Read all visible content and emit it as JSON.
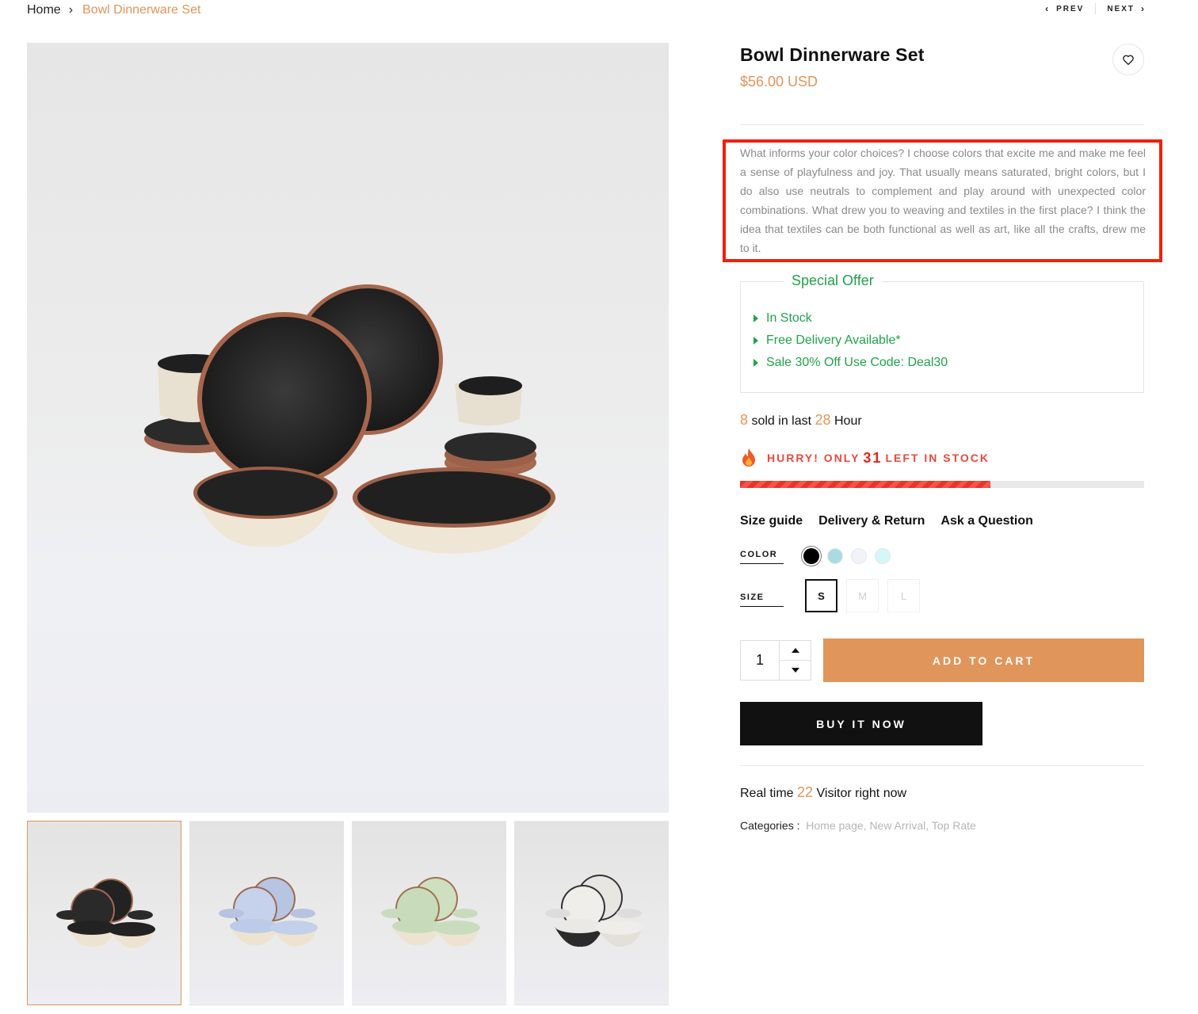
{
  "breadcrumb": {
    "home": "Home",
    "separator": "›",
    "current": "Bowl Dinnerware Set"
  },
  "pager": {
    "prev": "PREV",
    "next": "NEXT"
  },
  "product": {
    "title": "Bowl Dinnerware Set",
    "price": "$56.00 USD",
    "description": "What informs your color choices? I choose colors that excite me and make me feel a sense of playfulness and joy. That usually means saturated, bright colors, but I do also use neutrals to complement and play around with unexpected color combinations. What drew you to weaving and textiles in the first place? I think the idea that textiles can be both functional as well as art, like all the crafts, drew me to it."
  },
  "offer": {
    "title": "Special Offer",
    "items": [
      "In Stock",
      "Free Delivery Available*",
      "Sale 30% Off Use Code: Deal30"
    ]
  },
  "sold": {
    "count": "8",
    "text_mid": "sold in last",
    "hours": "28",
    "text_end": "Hour"
  },
  "stock": {
    "prefix": "HURRY! ONLY",
    "count": "31",
    "suffix": "LEFT IN STOCK",
    "level": 0.62
  },
  "links": {
    "size_guide": "Size guide",
    "delivery": "Delivery & Return",
    "ask": "Ask a Question"
  },
  "options": {
    "color_label": "COLOR",
    "colors": [
      "#000000",
      "#a9dbe2",
      "#f2f2fb",
      "#d4f7f7"
    ],
    "size_label": "SIZE",
    "sizes": [
      "S",
      "M",
      "L"
    ]
  },
  "quantity": "1",
  "buttons": {
    "add_to_cart": "ADD TO CART",
    "buy_now": "BUY IT NOW"
  },
  "visitors": {
    "prefix": "Real time",
    "count": "22",
    "suffix": "Visitor right now"
  },
  "categories": {
    "label": "Categories :",
    "items": [
      "Home page,",
      "New Arrival,",
      "Top Rate"
    ]
  },
  "colors": {
    "accent": "#e0955a",
    "green": "#1fa34a",
    "red": "#f0463c",
    "highlight": "#f01f0f"
  }
}
